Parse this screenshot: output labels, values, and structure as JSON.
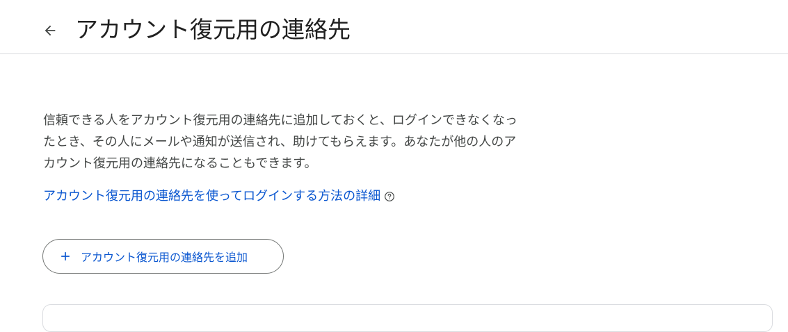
{
  "header": {
    "back_icon": "arrow-back-icon",
    "title": "アカウント復元用の連絡先"
  },
  "main": {
    "description": "信頼できる人をアカウント復元用の連絡先に追加しておくと、ログインできなくなったとき、その人にメールや通知が送信され、助けてもらえます。あなたが他の人のアカウント復元用の連絡先になることもできます。",
    "learn_more_link": "アカウント復元用の連絡先を使ってログインする方法の詳細",
    "help_icon": "help-circle-icon",
    "add_button": {
      "icon": "plus-icon",
      "label": "アカウント復元用の連絡先を追加"
    }
  },
  "colors": {
    "link": "#0b57d0",
    "text_primary": "#1f1f1f",
    "text_secondary": "#444746",
    "divider": "#dadce0",
    "button_outline": "#747775"
  }
}
